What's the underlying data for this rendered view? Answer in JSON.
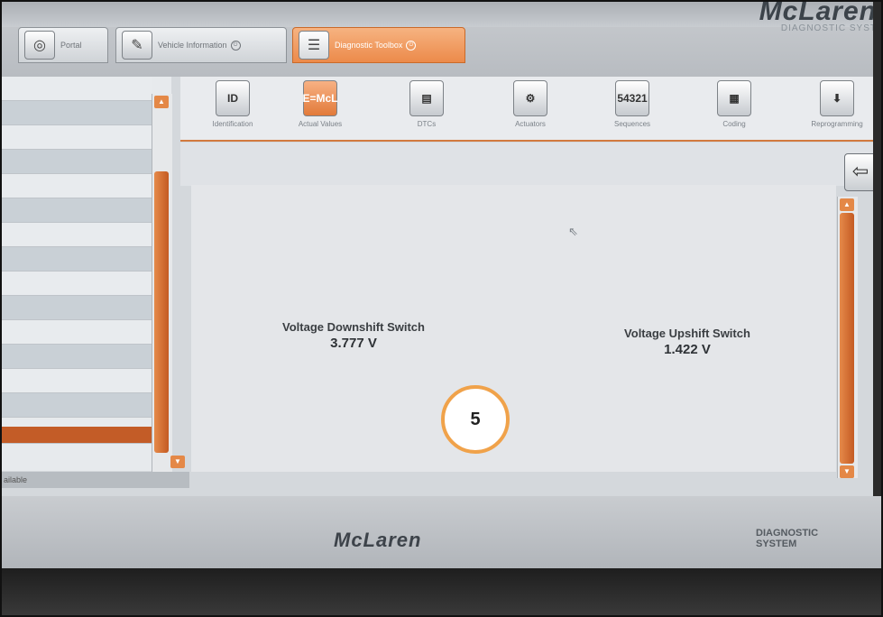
{
  "colors": {
    "accent": "#e8823f",
    "badge_border": "#f0a24a"
  },
  "top_tabs": [
    {
      "label": "Portal",
      "icon": "portal-icon"
    },
    {
      "label": "Vehicle Information",
      "icon": "vehicle-info-icon"
    },
    {
      "label": "Diagnostic Toolbox",
      "icon": "toolbox-icon",
      "active": true
    }
  ],
  "brand": {
    "name": "McLaren",
    "subtitle": "DIAGNOSTIC SYST"
  },
  "tools": [
    {
      "label": "Identification",
      "icon_text": "ID"
    },
    {
      "label": "Actual Values",
      "icon_text": "E=McL",
      "active": true
    },
    {
      "label": "DTCs",
      "icon_text": ""
    },
    {
      "label": "Actuators",
      "icon_text": ""
    },
    {
      "label": "Sequences",
      "icon_text": "54321"
    },
    {
      "label": "Coding",
      "icon_text": ""
    },
    {
      "label": "Reprogramming",
      "icon_text": ""
    }
  ],
  "values": [
    {
      "label": "Voltage Downshift Switch",
      "value": "3.777 V"
    },
    {
      "label": "Voltage Upshift Switch",
      "value": "1.422 V"
    }
  ],
  "status": {
    "text": "ailable"
  },
  "bezel": {
    "logo": "McLaren",
    "line1": "DIAGNOSTIC",
    "line2": "SYSTEM"
  },
  "badge": {
    "number": "5"
  }
}
